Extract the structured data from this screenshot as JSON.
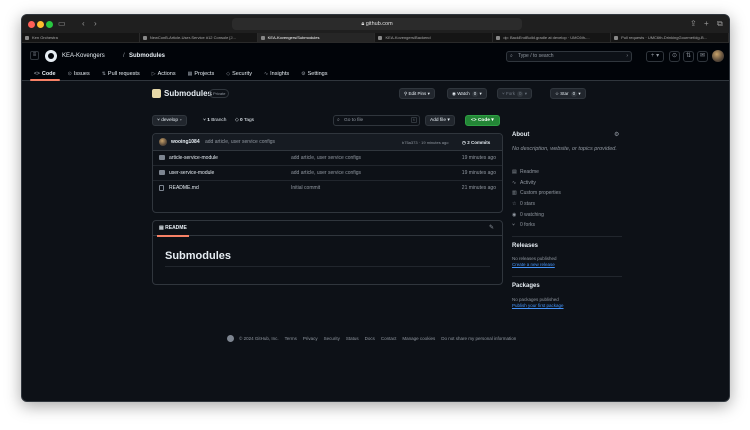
{
  "browser": {
    "url": "github.com",
    "tabs": [
      {
        "label": "Ken Orchestra",
        "active": false
      },
      {
        "label": "NewConB-Article-User-Service #12 Console [J...",
        "active": false
      },
      {
        "label": "KEA-Kovengers/Submodules",
        "active": true
      },
      {
        "label": "KEA-Kovengers/Backend",
        "active": false
      },
      {
        "label": "dp: BackEndBuild.gradle at develop · UMC6th-...",
        "active": false
      },
      {
        "label": "Pull requests · UMC6th-DrinkingGourmet/dg-B...",
        "active": false
      }
    ]
  },
  "header": {
    "owner": "KEA-Kovengers",
    "separator": "/",
    "repo": "Submodules",
    "search_placeholder": "Type / to search"
  },
  "nav": [
    {
      "label": "Code",
      "icon": "<>"
    },
    {
      "label": "Issues",
      "icon": "⊙"
    },
    {
      "label": "Pull requests",
      "icon": "⇅"
    },
    {
      "label": "Actions",
      "icon": "▷"
    },
    {
      "label": "Projects",
      "icon": "▦"
    },
    {
      "label": "Security",
      "icon": "◇"
    },
    {
      "label": "Insights",
      "icon": "∿"
    },
    {
      "label": "Settings",
      "icon": "⚙"
    }
  ],
  "repo": {
    "name": "Submodules",
    "visibility": "Private",
    "edit_pins": "Edit Pins",
    "watch_label": "Watch",
    "watch_count": "0",
    "fork_label": "Fork",
    "fork_count": "0",
    "star_label": "Star",
    "star_count": "0"
  },
  "toolbar": {
    "branch": "develop",
    "branches_count": "1",
    "branches_label": "Branch",
    "tags_count": "0",
    "tags_label": "Tags",
    "goto_placeholder": "Go to file",
    "goto_kbd": "t",
    "add_file": "Add file",
    "code": "Code"
  },
  "commit": {
    "author": "wooing1084",
    "message": "add article, user service configs",
    "meta": "b75a373 · 19 minutes ago",
    "count": "2 Commits"
  },
  "files": [
    {
      "name": "article-service-module",
      "message": "add article, user service configs",
      "date": "19 minutes ago",
      "type": "folder"
    },
    {
      "name": "user-service-module",
      "message": "add article, user service configs",
      "date": "19 minutes ago",
      "type": "folder"
    },
    {
      "name": "README.md",
      "message": "Initial commit",
      "date": "21 minutes ago",
      "type": "file"
    }
  ],
  "readme": {
    "tab": "README",
    "heading": "Submodules"
  },
  "about": {
    "title": "About",
    "description": "No description, website, or topics provided.",
    "items": [
      {
        "label": "Readme",
        "icon": "▤"
      },
      {
        "label": "Activity",
        "icon": "∿"
      },
      {
        "label": "Custom properties",
        "icon": "▥"
      },
      {
        "label": "0 stars",
        "icon": "☆"
      },
      {
        "label": "0 watching",
        "icon": "◉"
      },
      {
        "label": "0 forks",
        "icon": "⑂"
      }
    ]
  },
  "releases": {
    "title": "Releases",
    "empty": "No releases published",
    "link": "Create a new release"
  },
  "packages": {
    "title": "Packages",
    "empty": "No packages published",
    "link": "Publish your first package"
  },
  "footer": {
    "copyright": "© 2024 GitHub, Inc.",
    "links": [
      "Terms",
      "Privacy",
      "Security",
      "Status",
      "Docs",
      "Contact",
      "Manage cookies",
      "Do not share my personal information"
    ]
  },
  "colors": {
    "accent_green": "#238636",
    "link_blue": "#4493f8",
    "tab_underline": "#f78166",
    "background": "#0d1117"
  }
}
